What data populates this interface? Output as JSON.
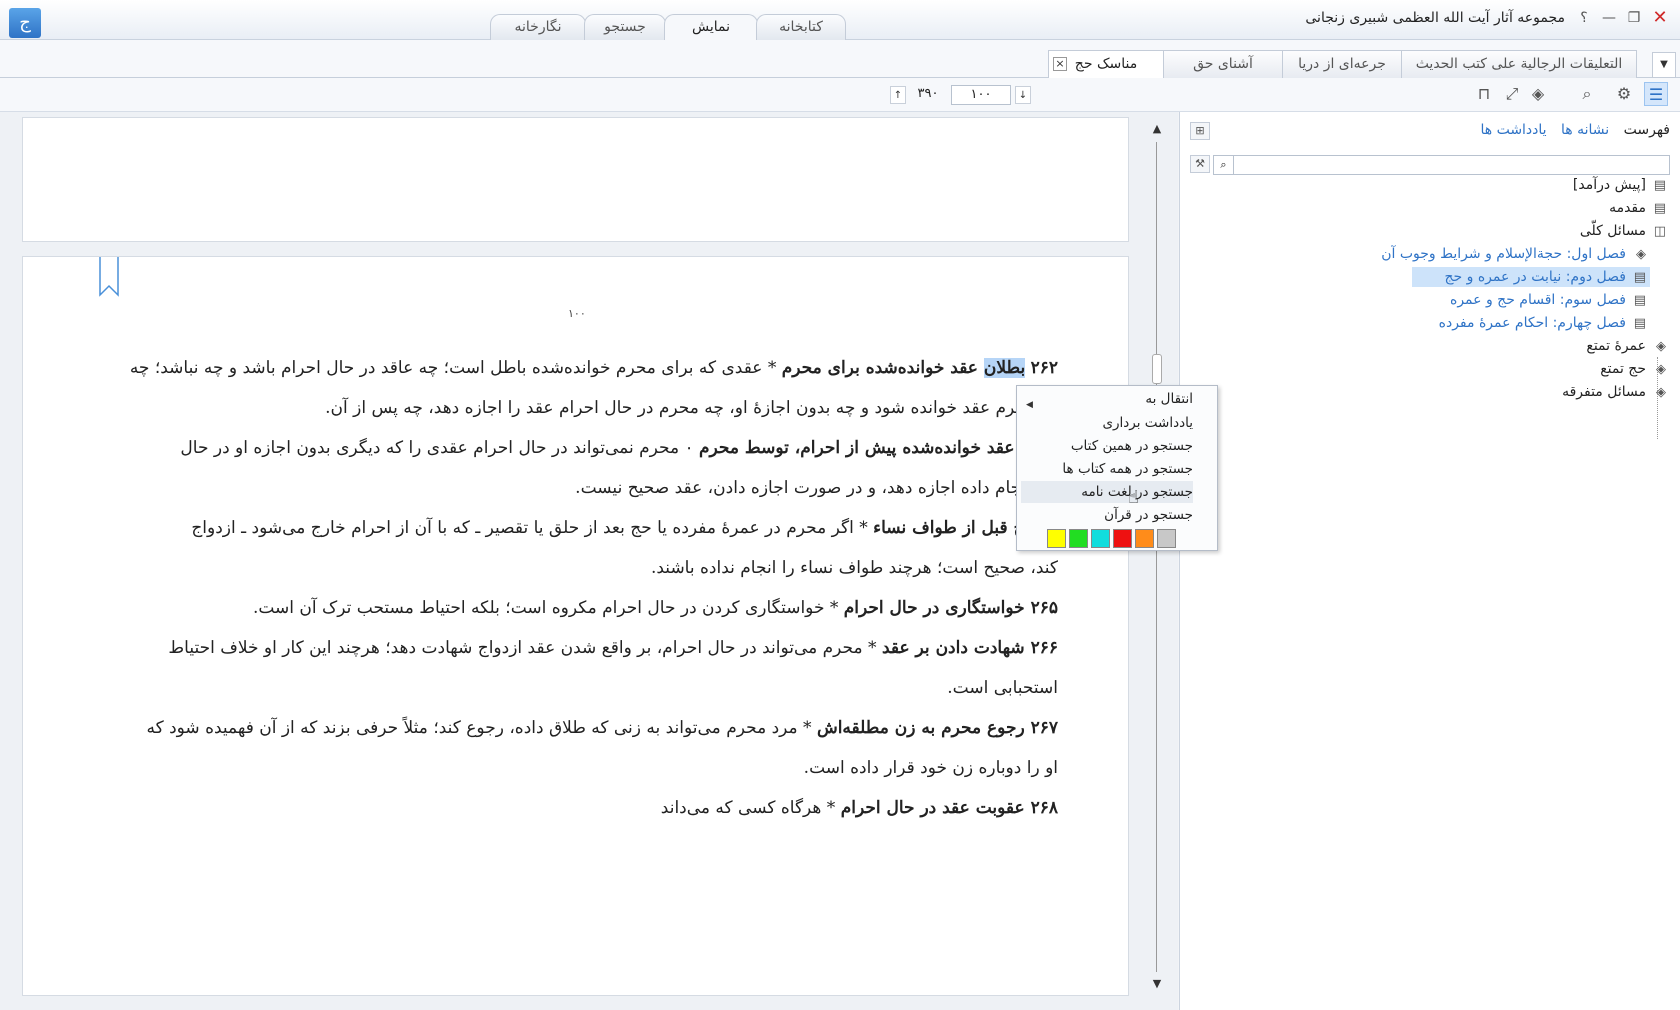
{
  "window": {
    "title": "مجموعه آثار آیت الله العظمی شبیری زنجانی",
    "help": "؟",
    "minimize": "—",
    "restore": "❐",
    "close": "✕",
    "logo": "ج"
  },
  "main_tabs": [
    {
      "label": "کتابخانه",
      "active": false
    },
    {
      "label": "نمایش",
      "active": true
    },
    {
      "label": "جستجو",
      "active": false
    },
    {
      "label": "نگارخانه",
      "active": false
    }
  ],
  "book_tabs": [
    {
      "label": "التعلیقات الرجالیة علی کتب الحدیث",
      "active": false
    },
    {
      "label": "جرعه‌ای از دریا",
      "active": false
    },
    {
      "label": "آشنای حق",
      "active": false
    },
    {
      "label": "مناسک حج",
      "active": true
    }
  ],
  "book_tab_close": "×",
  "book_tab_dropdown": "▼",
  "pager": {
    "current_page": "۱۰۰",
    "total_pages": "۳۹۰",
    "prev_arrow": "↓",
    "next_arrow": "↑"
  },
  "toolbar_icons": [
    "list-icon",
    "gear-icon",
    "search-icon",
    "layers-icon",
    "fullscreen-icon",
    "bookmark-icon"
  ],
  "side_panel": {
    "tabs": [
      {
        "label": "فهرست",
        "active": true
      },
      {
        "label": "نشانه ها",
        "active": false
      },
      {
        "label": "یادداشت ها",
        "active": false
      }
    ],
    "search_placeholder": "",
    "tree": [
      {
        "label": "[پیش درآمد]",
        "icon": "page-icon",
        "level": 0,
        "link": false,
        "selected": false
      },
      {
        "label": "مقدمه",
        "icon": "page-icon",
        "level": 0,
        "link": false,
        "selected": false
      },
      {
        "label": "مسائل کلّی",
        "icon": "book-open-icon",
        "level": 0,
        "link": false,
        "selected": false
      },
      {
        "label": "فصل اول: حجةالإسلام و شرایط وجوب آن",
        "icon": "layers-icon",
        "level": 1,
        "link": true,
        "selected": false
      },
      {
        "label": "فصل دوم: نیابت در عمره و حج",
        "icon": "page-icon",
        "level": 1,
        "link": true,
        "selected": true
      },
      {
        "label": "فصل سوم: اقسام حج و عمره",
        "icon": "page-icon",
        "level": 1,
        "link": true,
        "selected": false
      },
      {
        "label": "فصل چهارم: احکام عمرهٔ مفرده",
        "icon": "page-icon",
        "level": 1,
        "link": true,
        "selected": false
      },
      {
        "label": "عمرهٔ تمتع",
        "icon": "layers-icon",
        "level": 0,
        "link": false,
        "selected": false
      },
      {
        "label": "حج تمتع",
        "icon": "layers-icon",
        "level": 0,
        "link": false,
        "selected": false
      },
      {
        "label": "مسائل متفرقه",
        "icon": "layers-icon",
        "level": 0,
        "link": false,
        "selected": false
      }
    ]
  },
  "document": {
    "page_number": "۱۰۰",
    "paragraphs": [
      {
        "num": "۲۶۲",
        "highlight": "بطلان",
        "title": " عقد خوانده‌شده برای محرم",
        "body": " * عقدی که برای محرم خوانده‌شده باطل است؛ چه عاقد در حال احرام باشد و چه نباشد؛ چه"
      },
      {
        "num": "",
        "highlight": "",
        "title": "",
        "body": "زهٔ محرم عقد خوانده شود و چه بدون اجازهٔ او، چه محرم در حال احرام عقد را اجازه دهد، چه پس از آن."
      },
      {
        "num": "",
        "highlight": "",
        "title": " اجازهٔ عقد خوانده‌شده پیش از احرام، توسط محرم",
        "body": " ۰ محرم نمی‌تواند در حال احرام عقدی را که دیگری بدون اجازه او در حال"
      },
      {
        "num": "",
        "highlight": "",
        "title": "",
        "body": " وی انجام داده اجازه دهد، و در صورت اجازه دادن، عقد صحیح نیست."
      },
      {
        "num": "",
        "highlight": "",
        "title": " ازدواج قبل از طواف نساء",
        "body": " * اگر محرم در عمرهٔ مفرده یا حج بعد از حلق یا تقصیر ـ که با آن از احرام خارج می‌شود ـ ازدواج"
      },
      {
        "num": "",
        "highlight": "",
        "title": "",
        "body": "کند، صحیح است؛ هرچند طواف نساء را انجام نداده باشند."
      },
      {
        "num": "۲۶۵",
        "highlight": "",
        "title": " خواستگاری در حال احرام",
        "body": " * خواستگاری کردن در حال احرام مکروه است؛ بلکه احتیاط مستحب ترک آن است."
      },
      {
        "num": "۲۶۶",
        "highlight": "",
        "title": " شهادت دادن بر عقد",
        "body": " * محرم می‌تواند در حال احرام، بر واقع شدن عقد ازدواج شهادت دهد؛ هرچند این کار او خلاف احتیاط"
      },
      {
        "num": "",
        "highlight": "",
        "title": "",
        "body": "استحبابی است."
      },
      {
        "num": "۲۶۷",
        "highlight": "",
        "title": " رجوع محرم به زن مطلقه‌اش",
        "body": " * مرد محرم می‌تواند به زنی که طلاق داده، رجوع کند؛ مثلاً حرفی بزند که از آن فهمیده شود که"
      },
      {
        "num": "",
        "highlight": "",
        "title": "",
        "body": "او را دوباره زن خود قرار داده است."
      },
      {
        "num": "۲۶۸",
        "highlight": "",
        "title": " عقوبت عقد در حال احرام",
        "body": " * هرگاه کسی که می‌داند"
      }
    ]
  },
  "context_menu": {
    "items": [
      {
        "label": "انتقال به",
        "submenu": true,
        "hover": false
      },
      {
        "label": "یادداشت برداری",
        "submenu": false,
        "hover": false
      },
      {
        "label": "جستجو در همین کتاب",
        "submenu": false,
        "hover": false
      },
      {
        "label": "جستجو در همه کتاب ها",
        "submenu": false,
        "hover": false
      },
      {
        "label": "جستجو در لغت نامه",
        "submenu": false,
        "hover": true
      },
      {
        "label": "جستجو در قرآن",
        "submenu": false,
        "hover": false
      }
    ],
    "swatches": [
      "#ffff00",
      "#22dd22",
      "#11dddd",
      "#ee1111",
      "#ff8c1a",
      "#c8c8c8"
    ]
  }
}
